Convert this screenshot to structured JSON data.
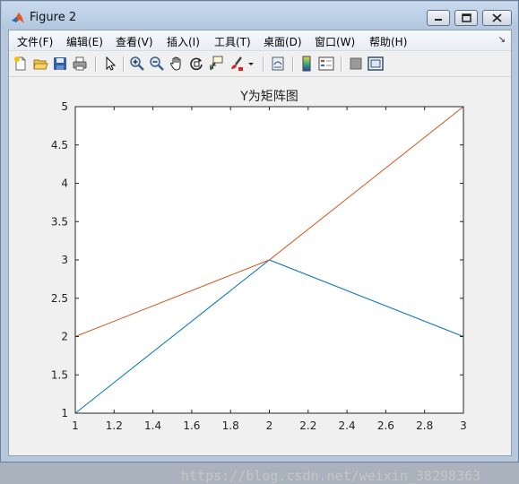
{
  "window": {
    "title": "Figure 2"
  },
  "menubar": {
    "items": [
      "文件(F)",
      "编辑(E)",
      "查看(V)",
      "插入(I)",
      "工具(T)",
      "桌面(D)",
      "窗口(W)",
      "帮助(H)"
    ]
  },
  "toolbar": {
    "icons": [
      "new-figure-icon",
      "open-file-icon",
      "save-icon",
      "print-icon",
      "edit-plot-arrow-icon",
      "zoom-in-icon",
      "zoom-out-icon",
      "pan-hand-icon",
      "rotate-3d-icon",
      "data-cursor-icon",
      "brush-icon",
      "brush-dropdown-icon",
      "link-plot-icon",
      "colorbar-icon",
      "legend-icon",
      "hide-plot-tools-icon",
      "show-plot-tools-icon"
    ]
  },
  "chart_data": {
    "type": "line",
    "title": "Y为矩阵图",
    "x": [
      1,
      2,
      3
    ],
    "series": [
      {
        "values": [
          1,
          3,
          2
        ],
        "color": "#0072bd"
      },
      {
        "values": [
          2,
          3,
          5
        ],
        "color": "#d95319"
      }
    ],
    "xlim": [
      1,
      3
    ],
    "ylim": [
      1,
      5
    ],
    "xticks": [
      "1",
      "1.2",
      "1.4",
      "1.6",
      "1.8",
      "2",
      "2.2",
      "2.4",
      "2.6",
      "2.8",
      "3"
    ],
    "yticks": [
      "1",
      "1.5",
      "2",
      "2.5",
      "3",
      "3.5",
      "4",
      "4.5",
      "5"
    ],
    "grid": false
  },
  "watermark": "https://blog.csdn.net/weixin_38298363"
}
